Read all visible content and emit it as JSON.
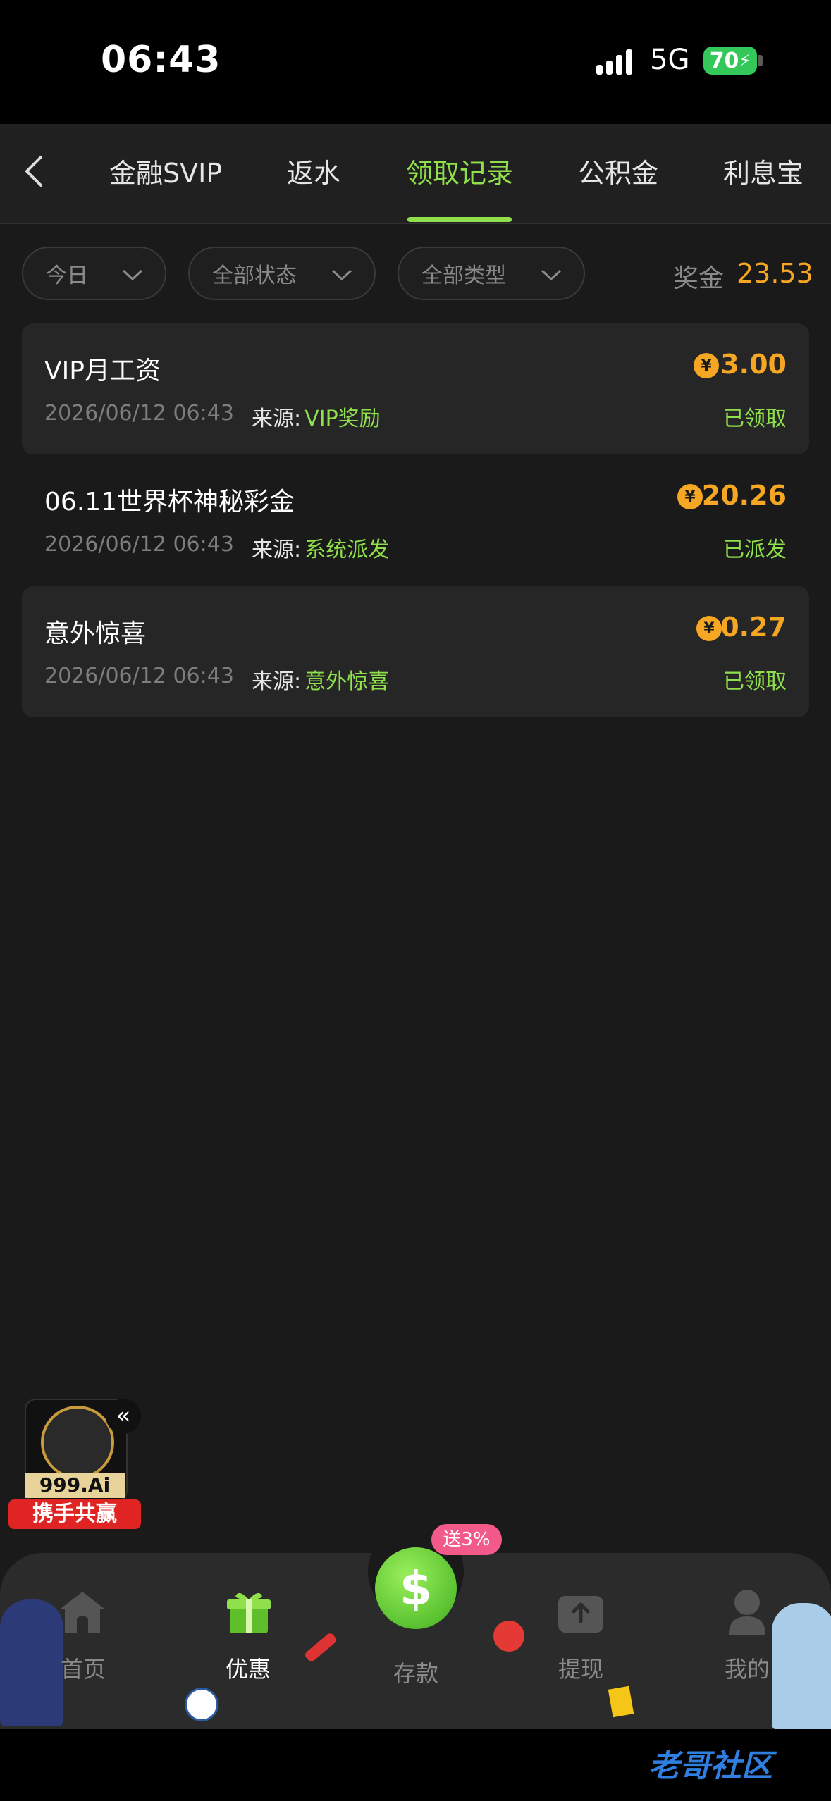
{
  "status_bar": {
    "time": "06:43",
    "network": "5G",
    "battery": "70"
  },
  "tabs": [
    {
      "label": "金融SVIP",
      "active": false
    },
    {
      "label": "返水",
      "active": false
    },
    {
      "label": "领取记录",
      "active": true
    },
    {
      "label": "公积金",
      "active": false
    },
    {
      "label": "利息宝",
      "active": false
    }
  ],
  "filters": {
    "date": "今日",
    "status": "全部状态",
    "type": "全部类型"
  },
  "bonus": {
    "label": "奖金",
    "value": "23.53"
  },
  "source_label": "来源:",
  "records": [
    {
      "title": "VIP月工资",
      "date": "2026/06/12 06:43",
      "source": "VIP奖励",
      "amount": "3.00",
      "status": "已领取"
    },
    {
      "title": "06.11世界杯神秘彩金",
      "date": "2026/06/12 06:43",
      "source": "系统派发",
      "amount": "20.26",
      "status": "已派发"
    },
    {
      "title": "意外惊喜",
      "date": "2026/06/12 06:43",
      "source": "意外惊喜",
      "amount": "0.27",
      "status": "已领取"
    }
  ],
  "float_badge": {
    "logo_text": "999.Ai",
    "banner": "携手共赢",
    "collapse": "«"
  },
  "bottom_nav": [
    {
      "label": "首页",
      "icon": "home-icon",
      "active": false
    },
    {
      "label": "优惠",
      "icon": "gift-icon",
      "active": true
    },
    {
      "label": "存款",
      "icon": "deposit-coin-icon",
      "active": false
    },
    {
      "label": "提现",
      "icon": "withdraw-icon",
      "active": false
    },
    {
      "label": "我的",
      "icon": "profile-icon",
      "active": false
    }
  ],
  "deposit_promo": "送3%",
  "watermark": "老哥社区",
  "colors": {
    "accent": "#8fe04b",
    "amount": "#f5a623",
    "background": "#1a1a1a"
  }
}
